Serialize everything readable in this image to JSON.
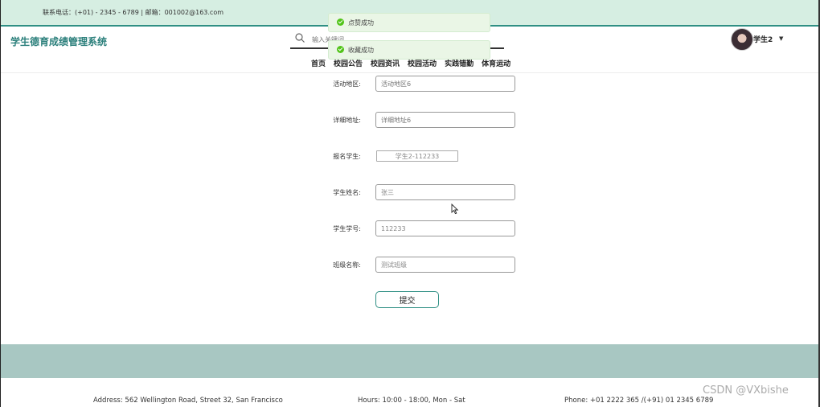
{
  "topbar": {
    "contact": "联系电话：(+01) - 2345 - 6789 | 邮箱：001002@163.com"
  },
  "header": {
    "site_title": "学生德育成绩管理系统",
    "search_placeholder": "输入关键词",
    "user_name": "学生2",
    "nav": [
      "首页",
      "校园公告",
      "校园资讯",
      "校园活动",
      "实践错勤",
      "体育运动"
    ]
  },
  "toasts": [
    {
      "message": "点赞成功"
    },
    {
      "message": "收藏成功"
    }
  ],
  "form": {
    "fields": [
      {
        "label": "活动地区:",
        "placeholder": "活动地区6"
      },
      {
        "label": "详细地址:",
        "placeholder": "详细地址6"
      },
      {
        "label": "报名学生:",
        "value": "学生2-112233"
      },
      {
        "label": "学生姓名:",
        "value": "张三"
      },
      {
        "label": "学生学号:",
        "value": "112233"
      },
      {
        "label": "班级名称:",
        "value": "测试班级"
      }
    ],
    "submit_label": "提交"
  },
  "footer": {
    "address": "Address: 562 Wellington Road, Street 32, San Francisco",
    "hours": "Hours: 10:00 - 18:00, Mon - Sat",
    "phone": "Phone: +01 2222 365 /(+91) 01 2345 6789"
  },
  "watermark": "CSDN @VXbishe",
  "colors": {
    "accent": "#2f8f84",
    "topbar_bg": "#d6eee2",
    "toast_bg": "#eaf6e6",
    "footer_band": "#a8c7c2"
  },
  "icons": {
    "search": "search-icon",
    "toast_success": "check-circle-icon",
    "caret": "caret-down-icon"
  }
}
